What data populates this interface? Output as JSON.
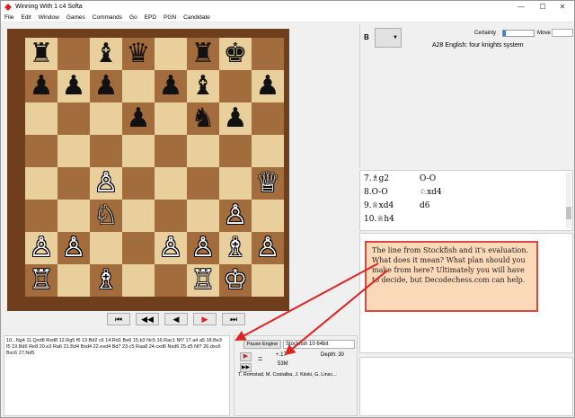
{
  "window": {
    "title": "Winning With 1 c4 Softa"
  },
  "menu": [
    "File",
    "Edit",
    "Window",
    "Games",
    "Commands",
    "Go",
    "EPD",
    "PGN",
    "Candidate"
  ],
  "board": {
    "pieces": [
      {
        "sq": "a8",
        "c": "b",
        "g": "♜"
      },
      {
        "sq": "c8",
        "c": "b",
        "g": "♝"
      },
      {
        "sq": "d8",
        "c": "b",
        "g": "♛"
      },
      {
        "sq": "f8",
        "c": "b",
        "g": "♜"
      },
      {
        "sq": "g8",
        "c": "b",
        "g": "♚"
      },
      {
        "sq": "a7",
        "c": "b",
        "g": "♟"
      },
      {
        "sq": "b7",
        "c": "b",
        "g": "♟"
      },
      {
        "sq": "c7",
        "c": "b",
        "g": "♟"
      },
      {
        "sq": "e7",
        "c": "b",
        "g": "♟"
      },
      {
        "sq": "f7",
        "c": "b",
        "g": "♝"
      },
      {
        "sq": "h7",
        "c": "b",
        "g": "♟"
      },
      {
        "sq": "d6",
        "c": "b",
        "g": "♟"
      },
      {
        "sq": "f6",
        "c": "b",
        "g": "♞"
      },
      {
        "sq": "g6",
        "c": "b",
        "g": "♟"
      },
      {
        "sq": "c4",
        "c": "w",
        "g": "♙"
      },
      {
        "sq": "h4",
        "c": "w",
        "g": "♕"
      },
      {
        "sq": "c3",
        "c": "w",
        "g": "♘"
      },
      {
        "sq": "g3",
        "c": "w",
        "g": "♙"
      },
      {
        "sq": "a2",
        "c": "w",
        "g": "♙"
      },
      {
        "sq": "b2",
        "c": "w",
        "g": "♙"
      },
      {
        "sq": "e2",
        "c": "w",
        "g": "♙"
      },
      {
        "sq": "f2",
        "c": "w",
        "g": "♙"
      },
      {
        "sq": "g2",
        "c": "w",
        "g": "♗"
      },
      {
        "sq": "h2",
        "c": "w",
        "g": "♙"
      },
      {
        "sq": "a1",
        "c": "w",
        "g": "♖"
      },
      {
        "sq": "c1",
        "c": "w",
        "g": "♗"
      },
      {
        "sq": "f1",
        "c": "w",
        "g": "♖"
      },
      {
        "sq": "g1",
        "c": "w",
        "g": "♔"
      }
    ]
  },
  "nav": {
    "first": "⏮",
    "prev_fast": "◀◀",
    "prev": "◀",
    "play": "▶",
    "next": "⏭"
  },
  "info": {
    "side": "B",
    "certainty_label": "Certainty",
    "certainty_level": 0.08,
    "move_label": "Move",
    "opening": "A28  English: four knights system"
  },
  "moves": [
    {
      "w": "7.♗g2",
      "b": "O-O"
    },
    {
      "w": "8.O-O",
      "b": "♘xd4"
    },
    {
      "w": "9.♕xd4",
      "b": "d6"
    },
    {
      "w": "10.♕h4",
      "b": ""
    }
  ],
  "pgn_text": "10...Ng4 11.Qxd8 Rxd8 12.Rg5 f6 13.Bd2 c6 14.Rd1 Be6 15.b3 Nc5 16.Rac1 Nf7 17.a4 a5 18.Be3 f5 19.Bd6 Re8 20.e3 Ra6 21.Bd4 Bxd4 22.exd4 Bd7 23.c5 Raa8 24.cxd6 Nxd6 25.d5 Nf7 26.dxc6 Bxc6 27.Nd5",
  "engine": {
    "pause_label": "Pause Engine",
    "name": "Stockfish 10 64bit",
    "eq": "=",
    "score": "+.17",
    "depth": "Depth: 30",
    "nodes": "53M",
    "authors": "T. Romstad, M. Costalba, J. Kiiski, G. Linsc..."
  },
  "callout": "The line from Stockfish and it's evaluation. What does it mean? What plan should you make from here? Ultimately you will have to decide, but Decodechess.com can help.",
  "colors": {
    "accent_red": "#e31b1b",
    "board_light": "#e9cf9c",
    "board_dark": "#a36c3c",
    "frame": "#6f3e1c",
    "callout_bg": "#fcd9b9",
    "callout_border": "#d84a45"
  }
}
